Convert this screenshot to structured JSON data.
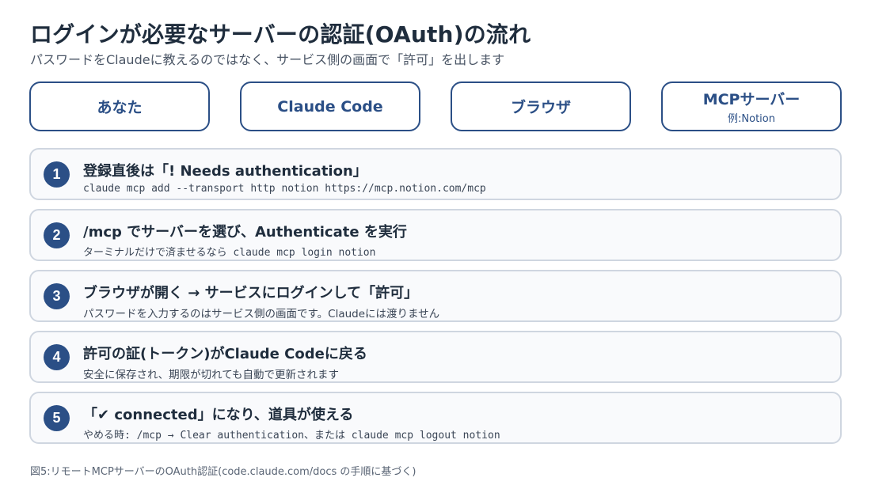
{
  "title": "ログインが必要なサーバーの認証(OAuth)の流れ",
  "subtitle": "パスワードをClaudeに教えるのではなく、サービス側の画面で「許可」を出します",
  "actors": [
    {
      "name": "あなた",
      "note": ""
    },
    {
      "name": "Claude Code",
      "note": ""
    },
    {
      "name": "ブラウザ",
      "note": ""
    },
    {
      "name": "MCPサーバー",
      "note": "例:Notion"
    }
  ],
  "steps": [
    {
      "num": "1",
      "title": "登録直後は「! Needs authentication」",
      "sub": "claude mcp add --transport http notion https://mcp.notion.com/mcp"
    },
    {
      "num": "2",
      "title": "/mcp でサーバーを選び、Authenticate を実行",
      "sub": "ターミナルだけで済ませるなら claude mcp login notion"
    },
    {
      "num": "3",
      "title": "ブラウザが開く → サービスにログインして「許可」",
      "sub": "パスワードを入力するのはサービス側の画面です。Claudeには渡りません"
    },
    {
      "num": "4",
      "title": "許可の証(トークン)がClaude Codeに戻る",
      "sub": "安全に保存され、期限が切れても自動で更新されます"
    },
    {
      "num": "5",
      "title": "「✔ connected」になり、道具が使える",
      "sub": "やめる時: /mcp → Clear authentication、または claude mcp logout notion"
    }
  ],
  "caption": "図5:リモートMCPサーバーのOAuth認証(code.claude.com/docs の手順に基づく)"
}
